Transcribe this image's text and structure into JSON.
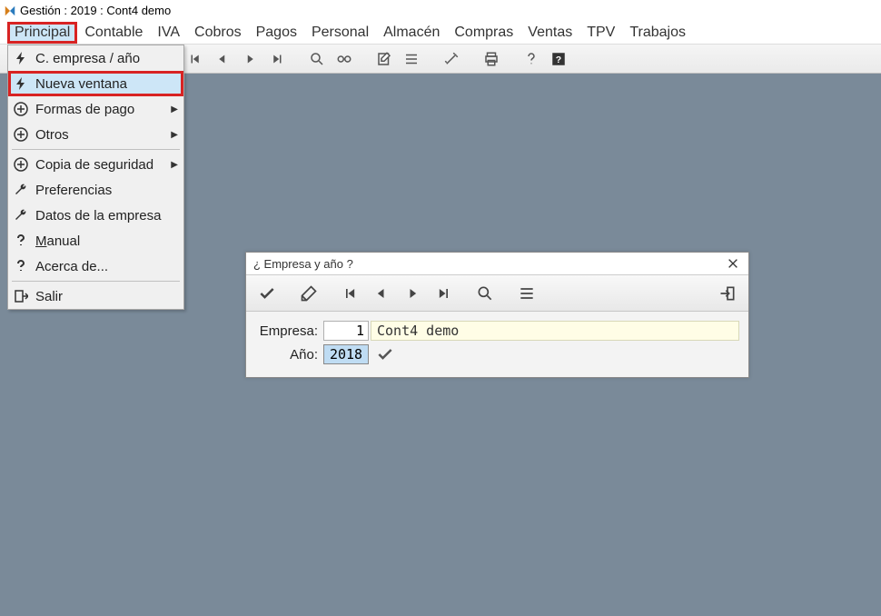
{
  "title": "Gestión : 2019 : Cont4 demo",
  "menubar": [
    "Principal",
    "Contable",
    "IVA",
    "Cobros",
    "Pagos",
    "Personal",
    "Almacén",
    "Compras",
    "Ventas",
    "TPV",
    "Trabajos"
  ],
  "dropdown": {
    "items": [
      {
        "icon": "bolt",
        "label": "C. empresa / año",
        "arrow": false
      },
      {
        "icon": "bolt",
        "label": "Nueva ventana",
        "arrow": false,
        "highlighted": true
      },
      {
        "icon": "plus",
        "label": "Formas de pago",
        "arrow": true
      },
      {
        "icon": "plus",
        "label": "Otros",
        "arrow": true
      },
      {
        "sep": true
      },
      {
        "icon": "plus",
        "label": "Copia de seguridad",
        "arrow": true
      },
      {
        "icon": "wrench",
        "label": "Preferencias",
        "arrow": false
      },
      {
        "icon": "wrench",
        "label": "Datos de la empresa",
        "arrow": false
      },
      {
        "icon": "question",
        "label": "Manual",
        "arrow": false,
        "underline": true
      },
      {
        "icon": "question",
        "label": "Acerca de...",
        "arrow": false
      },
      {
        "sep": true
      },
      {
        "icon": "exit",
        "label": "Salir",
        "arrow": false
      }
    ]
  },
  "dialog": {
    "title": "¿ Empresa y año ?",
    "empresa_label": "Empresa:",
    "empresa_num": "1",
    "empresa_name": "Cont4 demo",
    "ano_label": "Año:",
    "ano_value": "2018"
  }
}
